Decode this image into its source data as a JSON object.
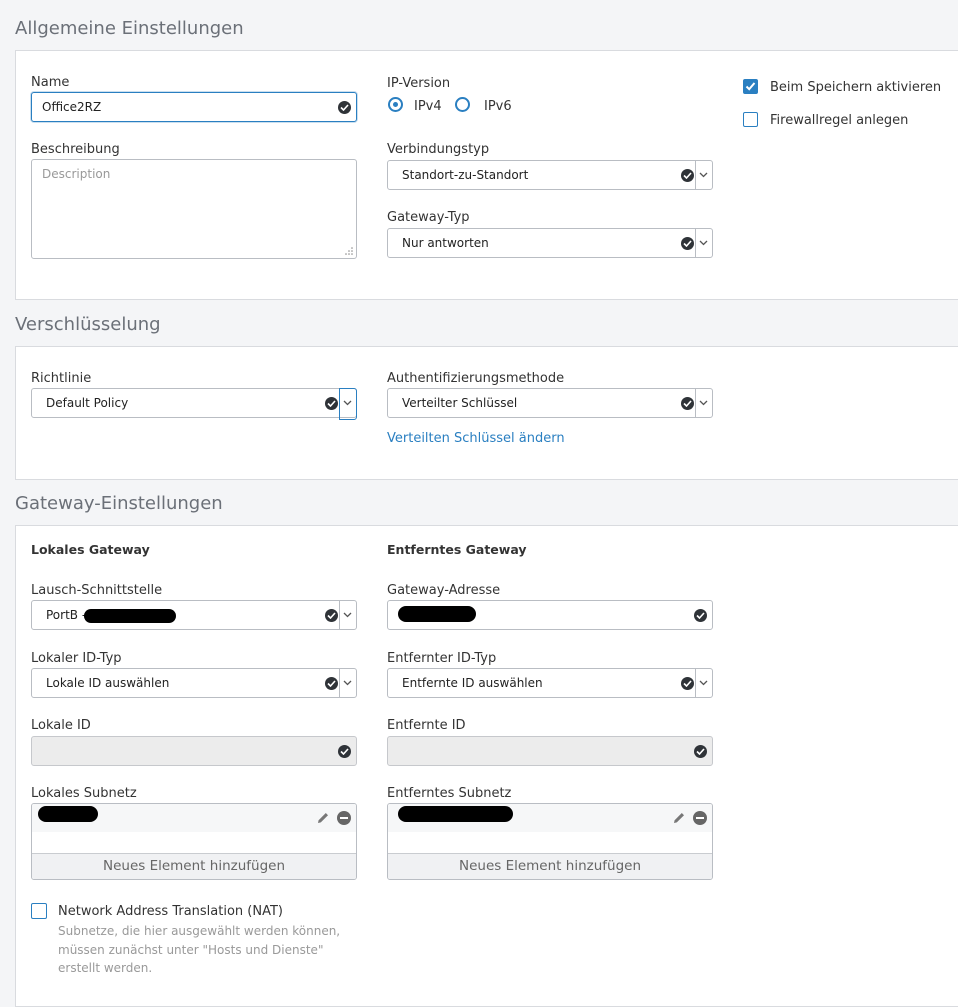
{
  "sections": {
    "general": "Allgemeine Einstellungen",
    "encryption": "Verschlüsselung",
    "gateway": "Gateway-Einstellungen"
  },
  "general": {
    "name_label": "Name",
    "name_value": "Office2RZ",
    "description_label": "Beschreibung",
    "description_placeholder": "Description",
    "ip_version_label": "IP-Version",
    "ipv4": "IPv4",
    "ipv6": "IPv6",
    "ip_version_selected": "IPv4",
    "connection_type_label": "Verbindungstyp",
    "connection_type_value": "Standort-zu-Standort",
    "gateway_type_label": "Gateway-Typ",
    "gateway_type_value": "Nur antworten",
    "activate_on_save_label": "Beim Speichern aktivieren",
    "activate_on_save_checked": true,
    "create_firewall_rule_label": "Firewallregel anlegen",
    "create_firewall_rule_checked": false
  },
  "encryption": {
    "policy_label": "Richtlinie",
    "policy_value": "Default Policy",
    "auth_method_label": "Authentifizierungsmethode",
    "auth_method_value": "Verteilter Schlüssel",
    "change_key_link": "Verteilten Schlüssel ändern"
  },
  "gateway": {
    "local_heading": "Lokales Gateway",
    "remote_heading": "Entferntes Gateway",
    "listen_interface_label": "Lausch-Schnittstelle",
    "listen_interface_value": "PortB -",
    "gateway_address_label": "Gateway-Adresse",
    "local_id_type_label": "Lokaler ID-Typ",
    "local_id_type_value": "Lokale ID auswählen",
    "remote_id_type_label": "Entfernter ID-Typ",
    "remote_id_type_value": "Entfernte ID auswählen",
    "local_id_label": "Lokale ID",
    "remote_id_label": "Entfernte ID",
    "local_subnet_label": "Lokales Subnetz",
    "remote_subnet_label": "Entferntes Subnetz",
    "add_item_label": "Neues Element hinzufügen",
    "nat_label": "Network Address Translation (NAT)",
    "nat_checked": false,
    "nat_hint_1": "Subnetze, die hier ausgewählt werden können,",
    "nat_hint_2": "müssen zunächst unter \"Hosts und Dienste\"",
    "nat_hint_3": "erstellt werden."
  },
  "colors": {
    "accent": "#2a7fc1",
    "background": "#f4f5f7"
  }
}
